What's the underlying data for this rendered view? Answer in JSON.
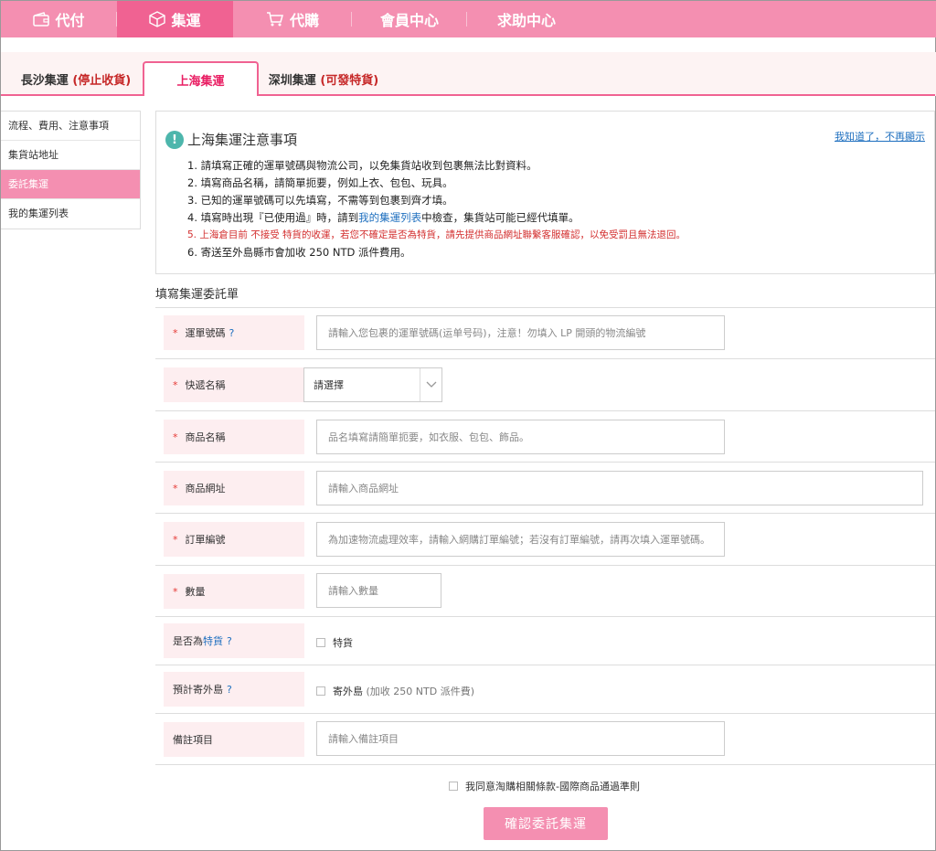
{
  "nav": {
    "items": [
      {
        "label": "代付",
        "icon": "wallet-icon"
      },
      {
        "label": "集運",
        "icon": "box-icon"
      },
      {
        "label": "代購",
        "icon": "cart-icon"
      },
      {
        "label": "會員中心",
        "icon": ""
      },
      {
        "label": "求助中心",
        "icon": ""
      }
    ],
    "active_index": 1
  },
  "tabs": [
    {
      "label": "長沙集運",
      "note": "(停止收貨)"
    },
    {
      "label": "上海集運",
      "note": ""
    },
    {
      "label": "深圳集運",
      "note": "(可發特貨)"
    }
  ],
  "sidebar": {
    "items": [
      {
        "label": "流程、費用、注意事項"
      },
      {
        "label": "集貨站地址"
      },
      {
        "label": "委託集運"
      },
      {
        "label": "我的集運列表"
      }
    ],
    "active_index": 2
  },
  "notice": {
    "title": "上海集運注意事項",
    "dismiss": "我知道了，不再顯示",
    "items": [
      "1. 請填寫正確的運單號碼與物流公司，以免集貨站收到包裹無法比對資料。",
      "2. 填寫商品名稱，請簡單扼要，例如上衣、包包、玩具。",
      "3. 已知的運單號碼可以先填寫，不需等到包裹到齊才填。",
      {
        "pre": "4. 填寫時出現『已使用過』時，請到",
        "link": "我的集運列表",
        "post": "中檢查，集貨站可能已經代填單。"
      },
      "5. 上海倉目前 不接受 特貨的收運，若您不確定是否為特貨，請先提供商品網址聯繫客服確認，以免受罰且無法退回。",
      "6. 寄送至外島縣市會加收 250 NTD 派件費用。"
    ]
  },
  "form": {
    "title": "填寫集運委託單",
    "tracking": {
      "label": "運單號碼",
      "hint": "?",
      "placeholder": "請輸入您包裹的運單號碼(运单号码)，注意！勿填入 LP 開頭的物流編號"
    },
    "courier": {
      "label": "快遞名稱",
      "value": "請選擇"
    },
    "product_name": {
      "label": "商品名稱",
      "placeholder": "品名填寫請簡單扼要，如衣服、包包、飾品。"
    },
    "product_url": {
      "label": "商品網址",
      "placeholder": "請輸入商品網址"
    },
    "order_no": {
      "label": "訂單編號",
      "placeholder": "為加速物流處理效率，請輸入網購訂單編號；若沒有訂單編號，請再次填入運單號碼。"
    },
    "quantity": {
      "label": "數量",
      "placeholder": "請輸入數量"
    },
    "special": {
      "label_pre": "是否為",
      "label_link": "特貨",
      "hint": "?",
      "option": "特貨"
    },
    "outlying": {
      "label": "預計寄外島",
      "hint": "?",
      "option": "寄外島",
      "option_note": "(加收 250 NTD 派件費)"
    },
    "remarks": {
      "label": "備註項目",
      "placeholder": "請輸入備註項目"
    }
  },
  "agreement": "我同意淘購相關條款-國際商品通過準則",
  "submit_label": "確認委託集運",
  "colors": {
    "nav_bg": "#f48fb1",
    "nav_active": "#f06292",
    "label_bg": "#fdeef0",
    "notice_icon": "#4db6ac",
    "link": "#1e6fbf",
    "warn": "#d32f2f"
  }
}
